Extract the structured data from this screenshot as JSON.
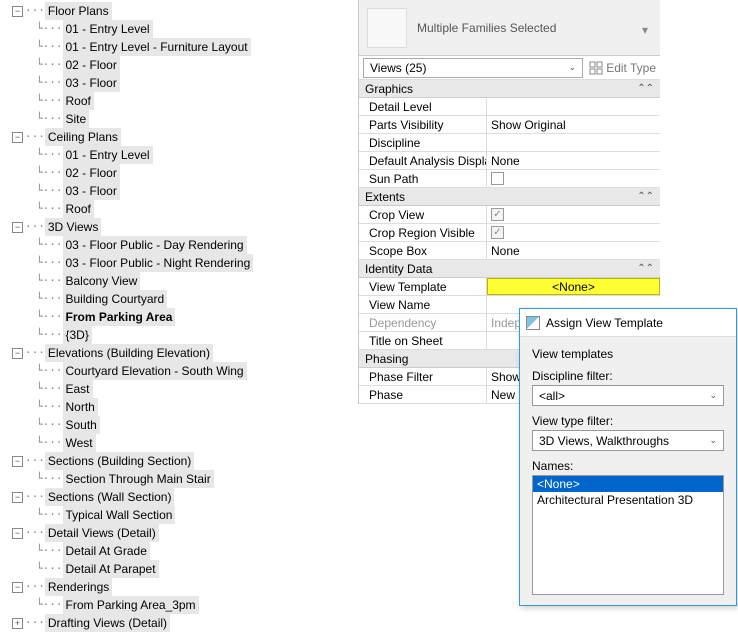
{
  "tree": {
    "floorPlans": {
      "label": "Floor Plans",
      "items": [
        "01 - Entry Level",
        "01 - Entry Level - Furniture Layout",
        "02 - Floor",
        "03 - Floor",
        "Roof",
        "Site"
      ]
    },
    "ceilingPlans": {
      "label": "Ceiling Plans",
      "items": [
        "01 - Entry Level",
        "02 - Floor",
        "03 - Floor",
        "Roof"
      ]
    },
    "threeD": {
      "label": "3D Views",
      "items": [
        "03 - Floor Public - Day Rendering",
        "03 - Floor Public - Night Rendering",
        "Balcony View",
        "Building Courtyard",
        "From Parking Area",
        "{3D}"
      ],
      "boldIndex": 4
    },
    "elevations": {
      "label": "Elevations (Building Elevation)",
      "items": [
        "Courtyard Elevation - South Wing",
        "East",
        "North",
        "South",
        "West"
      ]
    },
    "sectionsBldg": {
      "label": "Sections (Building Section)",
      "items": [
        "Section Through Main Stair"
      ]
    },
    "sectionsWall": {
      "label": "Sections (Wall Section)",
      "items": [
        "Typical Wall Section"
      ]
    },
    "detailViews": {
      "label": "Detail Views (Detail)",
      "items": [
        "Detail At Grade",
        "Detail At Parapet"
      ]
    },
    "renderings": {
      "label": "Renderings",
      "items": [
        "From Parking Area_3pm"
      ]
    },
    "drafting": {
      "label": "Drafting Views (Detail)"
    }
  },
  "props": {
    "headerText": "Multiple Families Selected",
    "typeSelectorLabel": "Views (25)",
    "editTypeLabel": "Edit Type",
    "categories": {
      "graphics": "Graphics",
      "extents": "Extents",
      "identity": "Identity Data",
      "phasing": "Phasing"
    },
    "rows": {
      "detailLevel": {
        "name": "Detail Level",
        "val": ""
      },
      "partsVisibility": {
        "name": "Parts Visibility",
        "val": "Show Original"
      },
      "discipline": {
        "name": "Discipline",
        "val": ""
      },
      "defaultAnalysis": {
        "name": "Default Analysis Display St...",
        "val": "None"
      },
      "sunPath": {
        "name": "Sun Path"
      },
      "cropView": {
        "name": "Crop View"
      },
      "cropRegion": {
        "name": "Crop Region Visible"
      },
      "scopeBox": {
        "name": "Scope Box",
        "val": "None"
      },
      "viewTemplate": {
        "name": "View Template",
        "val": "<None>"
      },
      "viewName": {
        "name": "View Name",
        "val": ""
      },
      "dependency": {
        "name": "Dependency",
        "val": "Indep"
      },
      "titleOnSheet": {
        "name": "Title on Sheet",
        "val": ""
      },
      "phaseFilter": {
        "name": "Phase Filter",
        "val": "Show"
      },
      "phase": {
        "name": "Phase",
        "val": "New"
      }
    }
  },
  "dialog": {
    "title": "Assign View Template",
    "groupLabel": "View templates",
    "disciplineLabel": "Discipline filter:",
    "disciplineValue": "<all>",
    "viewTypeLabel": "View type filter:",
    "viewTypeValue": "3D Views, Walkthroughs",
    "namesLabel": "Names:",
    "names": [
      "<None>",
      "Architectural Presentation 3D"
    ],
    "selectedIndex": 0
  }
}
